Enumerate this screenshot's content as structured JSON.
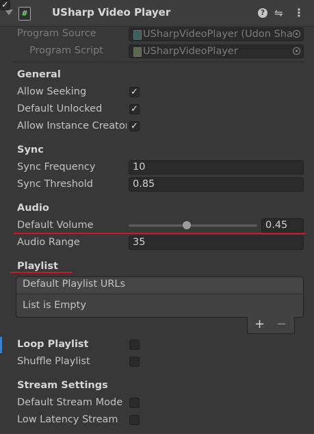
{
  "header": {
    "title": "USharp Video Player",
    "enabled": true,
    "icons": [
      "script-icon",
      "help-icon",
      "preset-icon",
      "kebab-menu-icon"
    ]
  },
  "program": {
    "source_label": "Program Source",
    "source_value": "USharpVideoPlayer (Udon Sha",
    "script_label": "Program Script",
    "script_value": "USharpVideoPlayer"
  },
  "general": {
    "heading": "General",
    "allow_seeking_label": "Allow Seeking",
    "allow_seeking": true,
    "default_unlocked_label": "Default Unlocked",
    "default_unlocked": true,
    "allow_instance_creator_label": "Allow Instance Creator",
    "allow_instance_creator": true
  },
  "sync": {
    "heading": "Sync",
    "frequency_label": "Sync Frequency",
    "frequency_value": "10",
    "threshold_label": "Sync Threshold",
    "threshold_value": "0.85"
  },
  "audio": {
    "heading": "Audio",
    "volume_label": "Default Volume",
    "volume_value": "0.45",
    "volume_fraction": 0.45,
    "range_label": "Audio Range",
    "range_value": "35"
  },
  "playlist": {
    "heading": "Playlist",
    "list_header": "Default Playlist URLs",
    "empty_text": "List is Empty",
    "add_label": "+",
    "remove_label": "−"
  },
  "loop": {
    "loop_label": "Loop Playlist",
    "loop": false,
    "shuffle_label": "Shuffle Playlist",
    "shuffle": false
  },
  "stream": {
    "heading": "Stream Settings",
    "default_mode_label": "Default Stream Mode",
    "default_mode": false,
    "low_latency_label": "Low Latency Stream",
    "low_latency": false
  },
  "colors": {
    "background": "#383838",
    "field": "#2a2a2a",
    "annotation_red": "#d0142c",
    "focus_blue": "#3f7fd0"
  }
}
